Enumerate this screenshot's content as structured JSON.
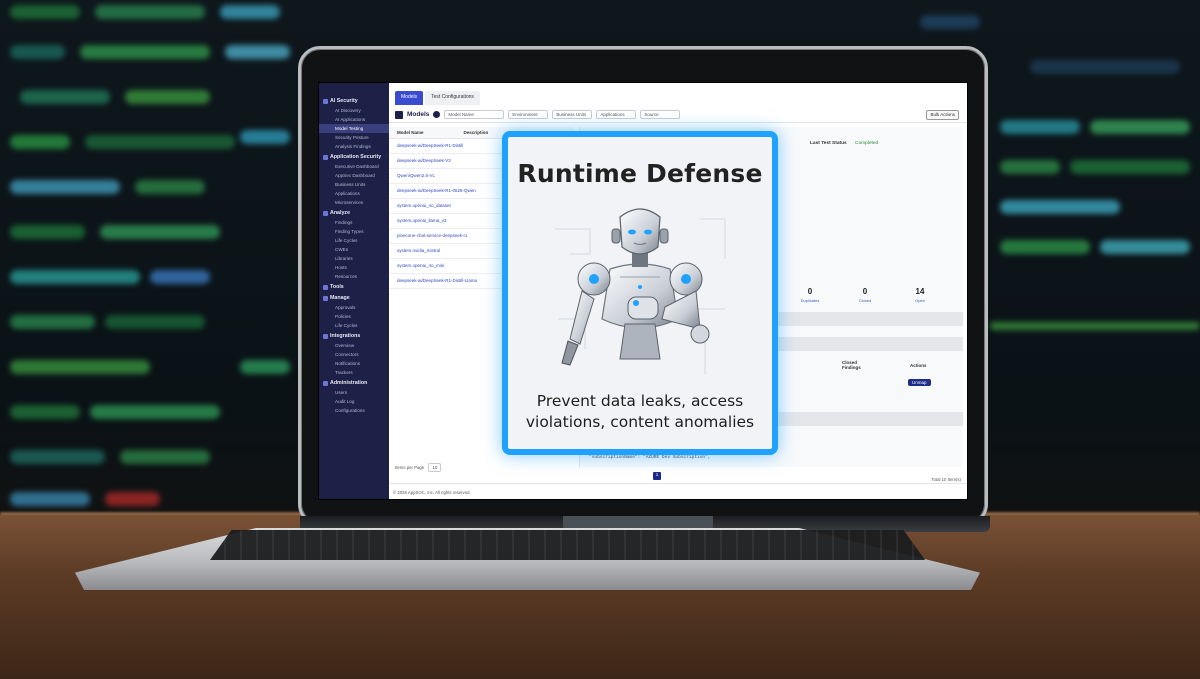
{
  "card": {
    "title": "Runtime Defense",
    "caption_line1": "Prevent data leaks, access",
    "caption_line2": "violations, content anomalies",
    "accent": "#1ea1ff"
  },
  "sidebar": {
    "groups": [
      {
        "label": "AI Security",
        "icon": "shield-icon",
        "items": [
          "AI Discovery",
          "AI Applications",
          "Model Testing",
          "Security Posture",
          "Analysis Findings"
        ]
      },
      {
        "label": "Application Security",
        "icon": "app-icon",
        "items": [
          "Executive Dashboard",
          "AppSec Dashboard",
          "Business Units",
          "Applications",
          "Microservices"
        ]
      },
      {
        "label": "Analyze",
        "icon": "analyze-icon",
        "items": [
          "Findings",
          "Finding Types",
          "Life Cycles",
          "CWEs",
          "Libraries",
          "Hosts",
          "Resources"
        ]
      },
      {
        "label": "Tools",
        "icon": "tools-icon",
        "items": []
      },
      {
        "label": "Manage",
        "icon": "manage-icon",
        "items": [
          "Approvals",
          "Policies",
          "Life Cycles"
        ]
      },
      {
        "label": "Integrations",
        "icon": "integrations-icon",
        "items": [
          "Overview",
          "Connectors",
          "Notifications",
          "Trackers"
        ]
      },
      {
        "label": "Administration",
        "icon": "admin-icon",
        "items": [
          "Users",
          "Audit Log",
          "Configurations"
        ]
      }
    ],
    "active_item": "Model Testing",
    "color": "#1d2148"
  },
  "tabs": [
    "Models",
    "Test Configurations"
  ],
  "toolbar": {
    "title": "Models",
    "search_placeholder": "Model Name",
    "filters": [
      "Environment",
      "Business Units",
      "Applications",
      "Source"
    ],
    "bulk_actions": "Bulk Actions"
  },
  "list": {
    "col_name": "Model Name",
    "col_desc": "Description",
    "rows": [
      "deepseek-ai/DeepSeek-R1-Distill",
      "deepseek-ai/DeepSeek-V3",
      "Qwen/Qwen2.5-VL",
      "deepseek-ai/DeepSeek-R1-0528-Qwen",
      "system.openai_4o_dataset",
      "system.openai_llama_v3",
      "pinecone-chat-service-deepseek-r1",
      "system.nvidia_mistral",
      "system.openai_4o_mini",
      "deepseek-ai/DeepSeek-R1-Distill-Llama"
    ]
  },
  "detail": {
    "last_test_status_label": "Last Test Status",
    "last_test_status": "Completed",
    "stats": [
      {
        "value": "0",
        "label": "Duplicates"
      },
      {
        "value": "0",
        "label": "Closed"
      },
      {
        "value": "14",
        "label": "Open"
      }
    ],
    "closed_findings_label": "Closed Findings",
    "actions_label": "Actions",
    "unmap_label": "Unmap",
    "code_line": "\"subscriptionName\": \"AZURE Dev Subscription\","
  },
  "footer": {
    "items_per_page_label": "Items per Page",
    "items_per_page": "10",
    "total": "Total 10 Item(s)",
    "page": "1",
    "copyright": "© 2025 AppSOC, Inc. All rights reserved."
  }
}
